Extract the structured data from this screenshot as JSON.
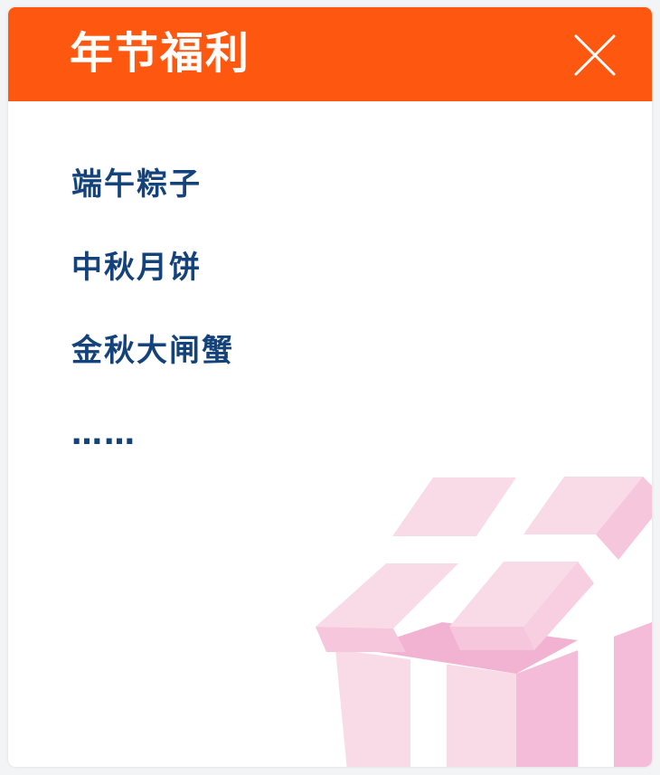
{
  "header": {
    "title": "年节福利",
    "background_color": "#fe5710",
    "close_icon": "close-icon"
  },
  "benefits": {
    "items": [
      {
        "label": "端午粽子"
      },
      {
        "label": "中秋月饼"
      },
      {
        "label": "金秋大闸蟹"
      },
      {
        "label": "……"
      }
    ],
    "text_color": "#14427a"
  },
  "decoration": {
    "icon": "gift-box-icon",
    "colors": [
      "#f9dbe7",
      "#f5c6dc",
      "#f1b3d1"
    ]
  }
}
